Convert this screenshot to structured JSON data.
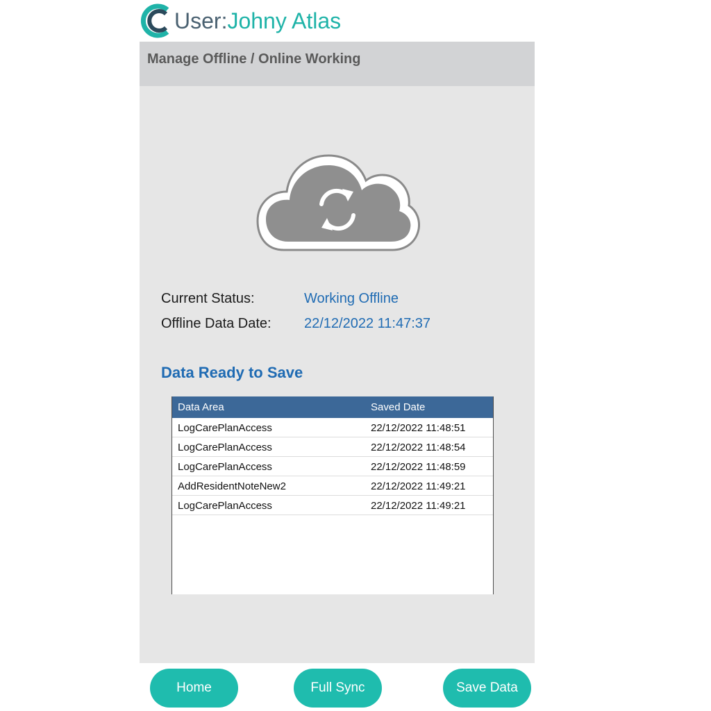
{
  "header": {
    "logo_icon": "c-logo-icon",
    "user_label": "User:",
    "user_name": "Johny Atlas",
    "colors": {
      "label": "#4a6171",
      "name": "#1fb3a8"
    }
  },
  "title_bar": {
    "title": "Manage Offline / Online Working"
  },
  "sync_icon": "cloud-sync-icon",
  "status": {
    "current_label": "Current Status:",
    "current_value": "Working Offline",
    "date_label": "Offline Data Date:",
    "date_value": "22/12/2022 11:47:37"
  },
  "section": {
    "title": "Data Ready to Save"
  },
  "grid": {
    "columns": [
      "Data Area",
      "Saved Date"
    ],
    "rows": [
      [
        "LogCarePlanAccess",
        "22/12/2022 11:48:51"
      ],
      [
        "LogCarePlanAccess",
        "22/12/2022 11:48:54"
      ],
      [
        "LogCarePlanAccess",
        "22/12/2022 11:48:59"
      ],
      [
        "AddResidentNoteNew2",
        "22/12/2022 11:49:21"
      ],
      [
        "LogCarePlanAccess",
        "22/12/2022 11:49:21"
      ]
    ]
  },
  "footer": {
    "home_label": "Home",
    "sync_label": "Full Sync",
    "save_label": "Save Data",
    "button_color": "#1fbcae"
  }
}
